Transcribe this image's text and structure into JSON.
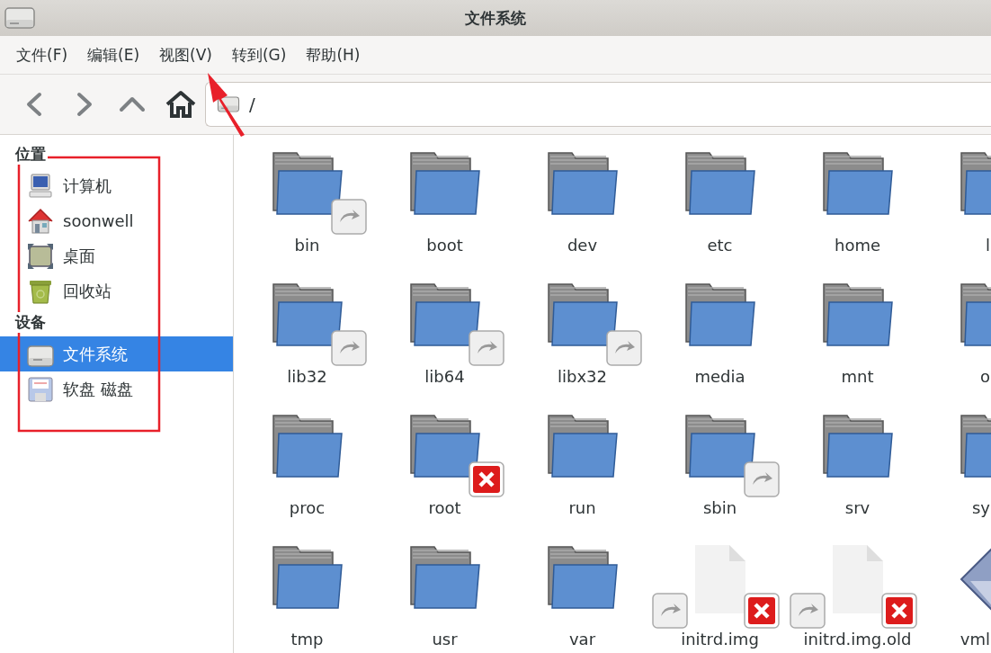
{
  "window": {
    "title": "文件系统"
  },
  "menu": [
    "文件(F)",
    "编辑(E)",
    "视图(V)",
    "转到(G)",
    "帮助(H)"
  ],
  "location": {
    "value": "/"
  },
  "sidebar": {
    "sections": [
      {
        "heading": "位置",
        "items": [
          {
            "label": "计算机",
            "kind": "computer",
            "selected": false
          },
          {
            "label": "soonwell",
            "kind": "home",
            "selected": false
          },
          {
            "label": "桌面",
            "kind": "desktop",
            "selected": false
          },
          {
            "label": "回收站",
            "kind": "trash",
            "selected": false
          }
        ]
      },
      {
        "heading": "设备",
        "items": [
          {
            "label": "文件系统",
            "kind": "drive",
            "selected": true
          },
          {
            "label": "软盘 磁盘",
            "kind": "floppy",
            "selected": false
          }
        ]
      }
    ]
  },
  "files": [
    {
      "name": "bin",
      "kind": "folder",
      "link": true,
      "no_access": false
    },
    {
      "name": "boot",
      "kind": "folder",
      "link": false,
      "no_access": false
    },
    {
      "name": "dev",
      "kind": "folder",
      "link": false,
      "no_access": false
    },
    {
      "name": "etc",
      "kind": "folder",
      "link": false,
      "no_access": false
    },
    {
      "name": "home",
      "kind": "folder",
      "link": false,
      "no_access": false
    },
    {
      "name": "l",
      "kind": "folder",
      "link": false,
      "no_access": false
    },
    {
      "name": "lib32",
      "kind": "folder",
      "link": true,
      "no_access": false
    },
    {
      "name": "lib64",
      "kind": "folder",
      "link": true,
      "no_access": false
    },
    {
      "name": "libx32",
      "kind": "folder",
      "link": true,
      "no_access": false
    },
    {
      "name": "media",
      "kind": "folder",
      "link": false,
      "no_access": false
    },
    {
      "name": "mnt",
      "kind": "folder",
      "link": false,
      "no_access": false
    },
    {
      "name": "o",
      "kind": "folder",
      "link": false,
      "no_access": false
    },
    {
      "name": "proc",
      "kind": "folder",
      "link": false,
      "no_access": false
    },
    {
      "name": "root",
      "kind": "folder",
      "link": false,
      "no_access": true
    },
    {
      "name": "run",
      "kind": "folder",
      "link": false,
      "no_access": false
    },
    {
      "name": "sbin",
      "kind": "folder",
      "link": true,
      "no_access": false
    },
    {
      "name": "srv",
      "kind": "folder",
      "link": false,
      "no_access": false
    },
    {
      "name": "sy",
      "kind": "folder",
      "link": false,
      "no_access": false
    },
    {
      "name": "tmp",
      "kind": "folder",
      "link": false,
      "no_access": false
    },
    {
      "name": "usr",
      "kind": "folder",
      "link": false,
      "no_access": false
    },
    {
      "name": "var",
      "kind": "folder",
      "link": false,
      "no_access": false
    },
    {
      "name": "initrd.img",
      "kind": "file",
      "link": true,
      "no_access": true
    },
    {
      "name": "initrd.img.old",
      "kind": "file",
      "link": true,
      "no_access": true
    },
    {
      "name": "vml",
      "kind": "kernel",
      "link": false,
      "no_access": false
    }
  ]
}
